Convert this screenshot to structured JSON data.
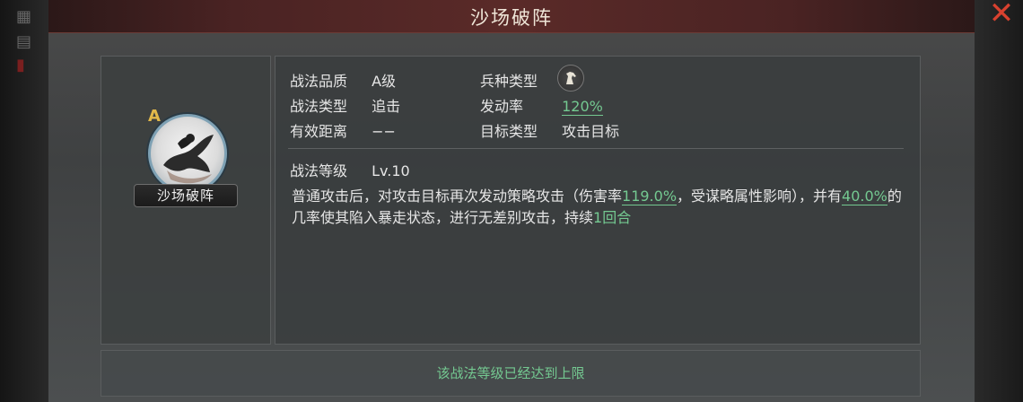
{
  "dialog": {
    "title": "沙场破阵",
    "close_glyph": "✕"
  },
  "skill": {
    "grade": "A",
    "name": "沙场破阵",
    "icon": "warrior-portrait-icon"
  },
  "attributes": {
    "quality_label": "战法品质",
    "quality_value": "A级",
    "type_label": "战法类型",
    "type_value": "追击",
    "range_label": "有效距离",
    "range_value": "−−",
    "troop_label": "兵种类型",
    "troop_icon": "cavalry-horse-icon",
    "rate_label": "发动率",
    "rate_value": "120%",
    "target_label": "目标类型",
    "target_value": "攻击目标",
    "level_label": "战法等级",
    "level_value": "Lv.10"
  },
  "description": {
    "part1": "普通攻击后，对攻击目标再次发动策略攻击（伤害率",
    "damage_rate": "119.0%",
    "part2": "，受谋略属性影响），并有",
    "chance": "40.0%",
    "part3": "的几率使其陷入暴走状态，进行无差别攻击，持续",
    "duration": "1回合"
  },
  "footer": {
    "max_level_text": "该战法等级已经达到上限"
  },
  "colors": {
    "highlight_green": "#74c991",
    "grade_gold": "#e2b94a",
    "close_red": "#d8412f"
  }
}
